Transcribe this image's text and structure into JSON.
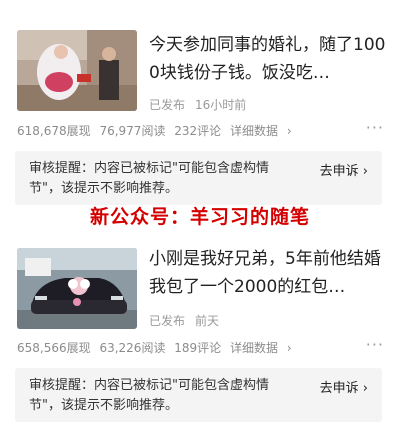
{
  "articles": [
    {
      "title": "今天参加同事的婚礼，随了1000块钱份子钱。饭没吃…",
      "status": "已发布",
      "time": "16小时前",
      "impressions": "618,678展现",
      "reads": "76,977阅读",
      "comments": "232评论",
      "details": "详细数据",
      "notice": "审核提醒：内容已被标记\"可能包含虚构情节\"，该提示不影响推荐。",
      "appeal": "去申诉"
    },
    {
      "title": "小刚是我好兄弟，5年前他结婚我包了一个2000的红包…",
      "status": "已发布",
      "time": "前天",
      "impressions": "658,566展现",
      "reads": "63,226阅读",
      "comments": "189评论",
      "details": "详细数据",
      "notice": "审核提醒：内容已被标记\"可能包含虚构情节\"，该提示不影响推荐。",
      "appeal": "去申诉"
    }
  ],
  "watermark": "新公众号：羊习习的随笔",
  "icons": {
    "more": "more-dots-icon",
    "chevron": "chevron-right-icon"
  }
}
